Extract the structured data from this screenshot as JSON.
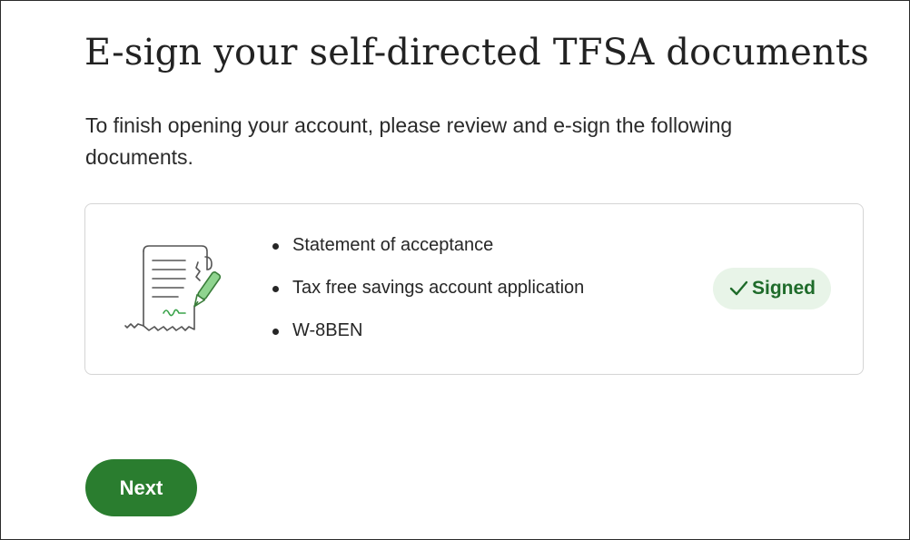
{
  "page": {
    "title": "E-sign your self-directed TFSA documents",
    "intro": "To finish opening your account, please review and e-sign the following documents."
  },
  "documents_card": {
    "illustration_icon": "document-signing-icon",
    "items": [
      {
        "label": "Statement of acceptance"
      },
      {
        "label": "Tax free savings account application"
      },
      {
        "label": "W-8BEN"
      }
    ],
    "status": {
      "icon": "checkmark-icon",
      "label": "Signed",
      "color": "#1e6b2a",
      "background": "#e8f4e8"
    }
  },
  "actions": {
    "next_label": "Next",
    "next_color": "#2a7d2f"
  }
}
